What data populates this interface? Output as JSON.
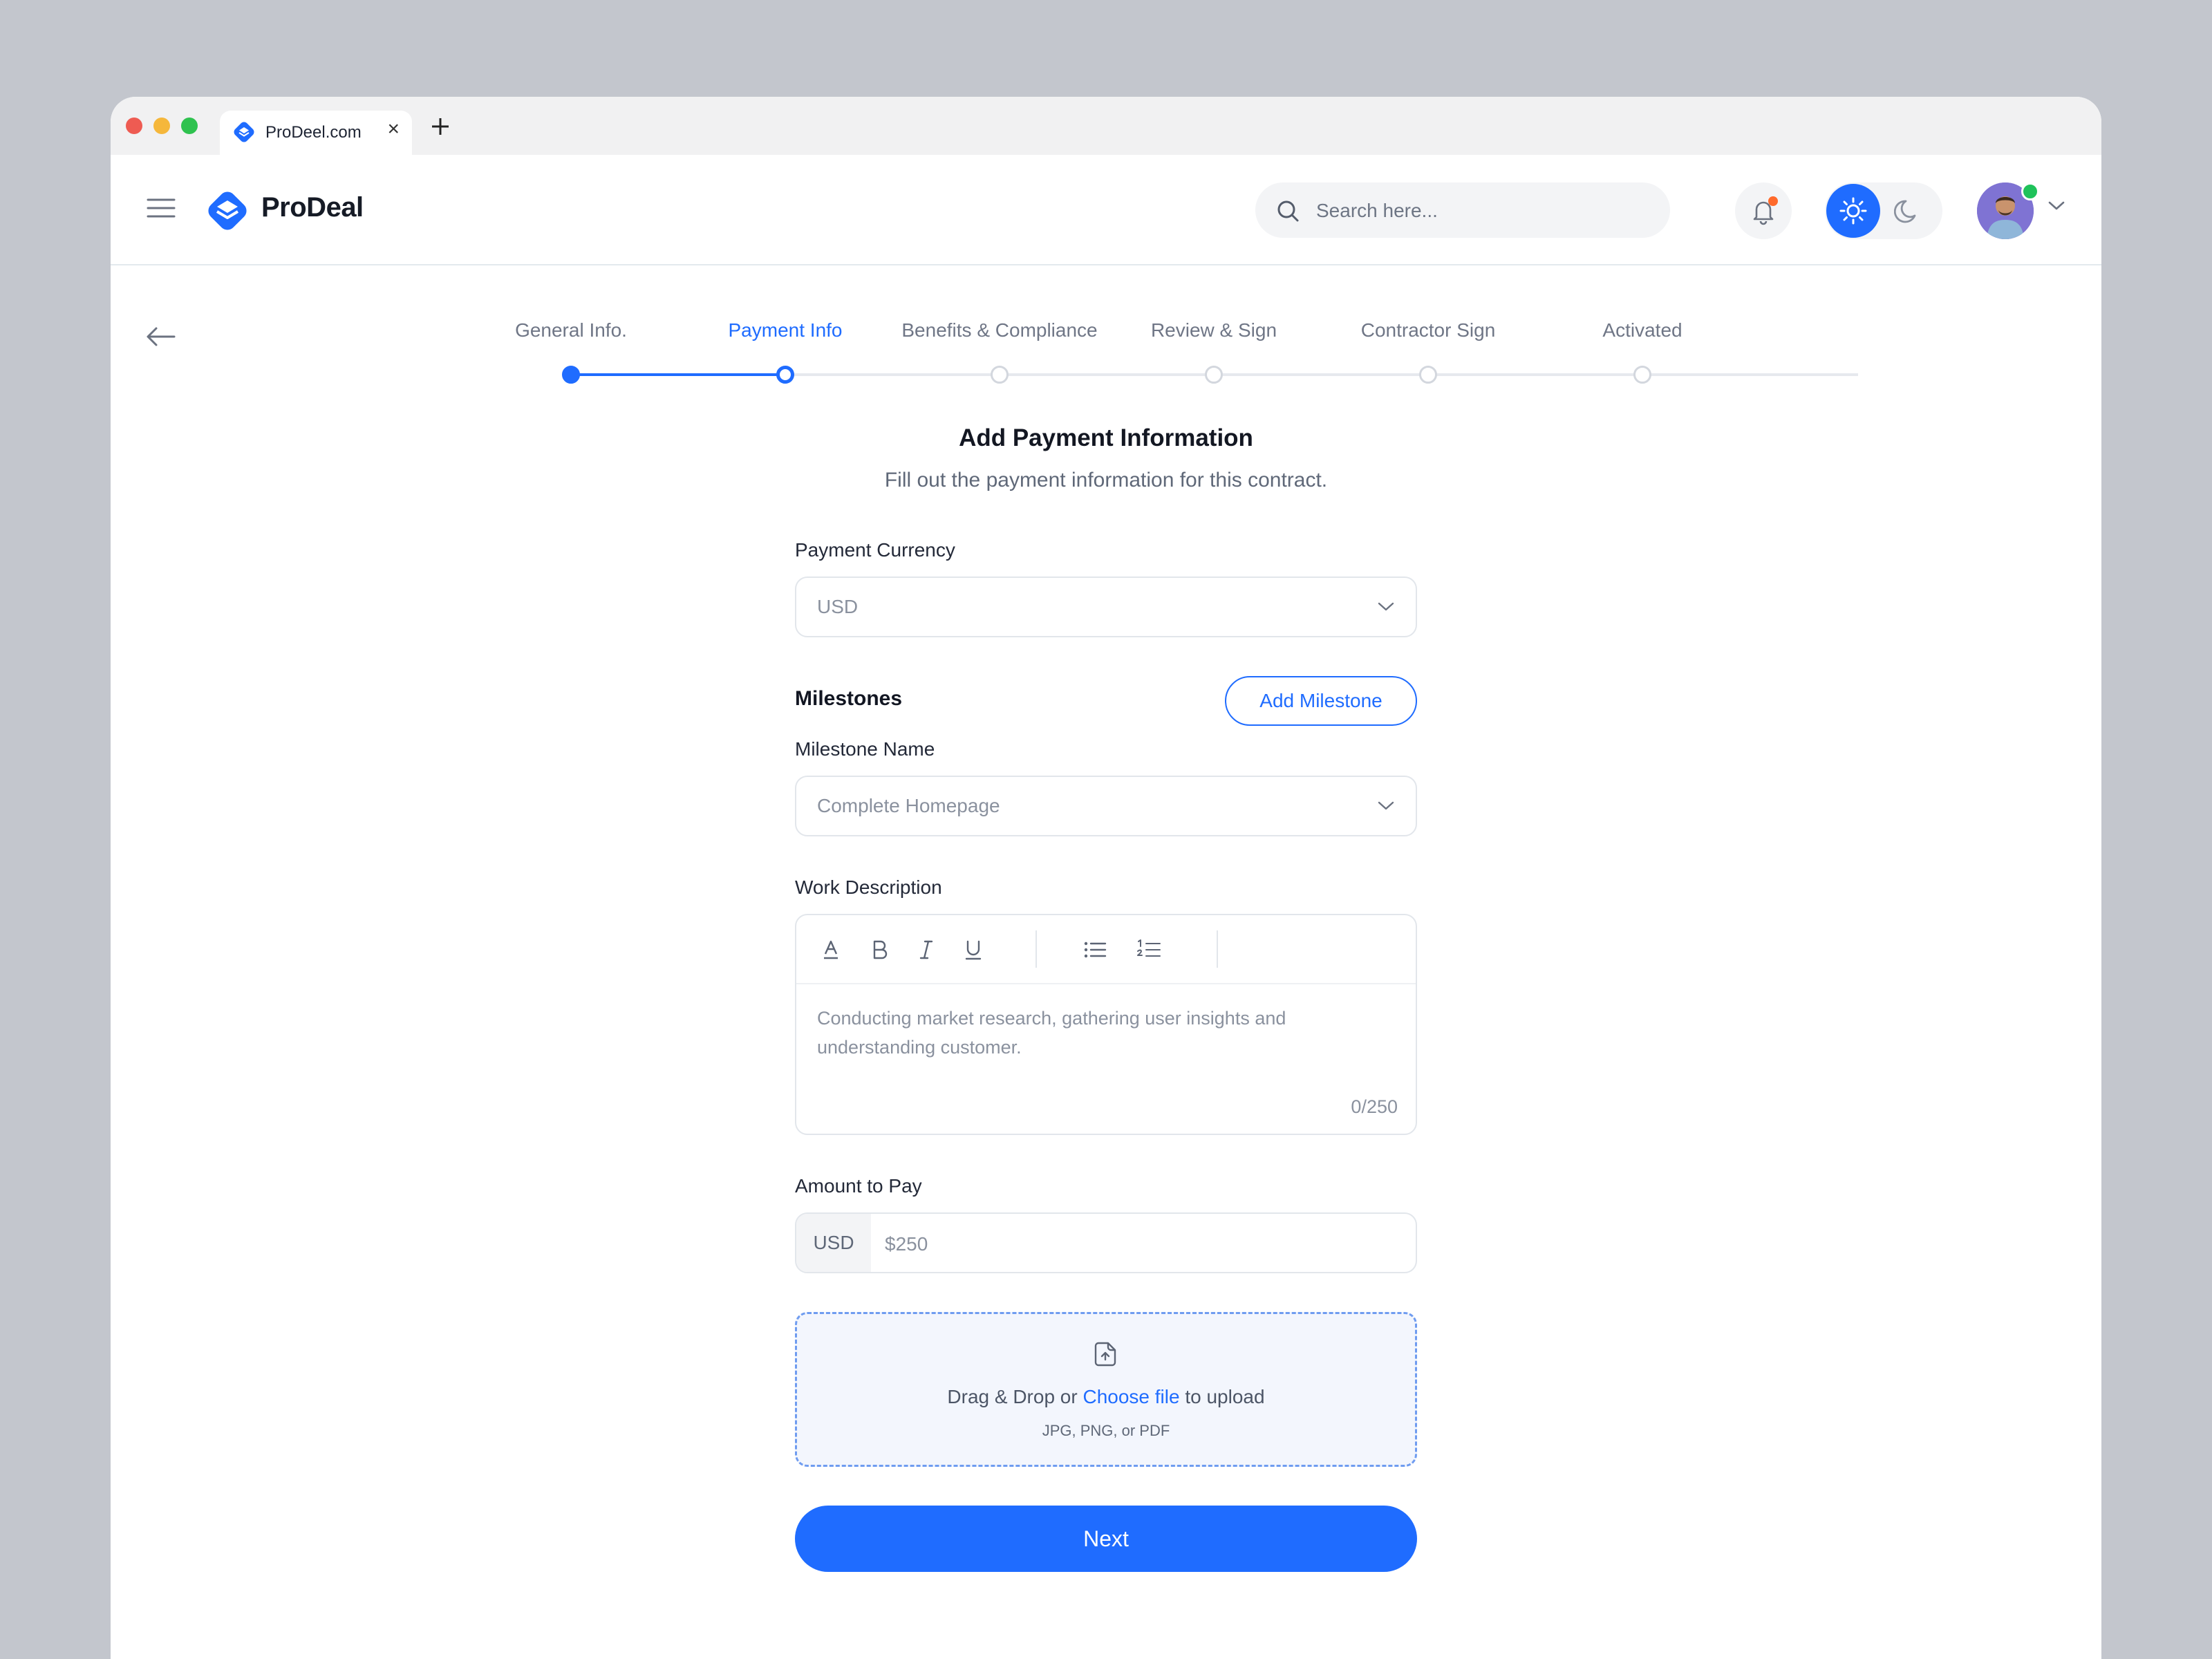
{
  "browser": {
    "tab_title": "ProDeel.com",
    "tab_close": "×"
  },
  "header": {
    "brand": "ProDeal",
    "search_placeholder": "Search here..."
  },
  "stepper": {
    "steps": [
      {
        "label": "General Info.",
        "state": "done"
      },
      {
        "label": "Payment Info",
        "state": "active"
      },
      {
        "label": "Benefits & Compliance",
        "state": "todo"
      },
      {
        "label": "Review & Sign",
        "state": "todo"
      },
      {
        "label": "Contractor Sign",
        "state": "todo"
      },
      {
        "label": "Activated",
        "state": "todo"
      }
    ]
  },
  "form": {
    "title": "Add Payment Information",
    "subtitle": "Fill out the payment information for this contract.",
    "currency_label": "Payment Currency",
    "currency_value": "USD",
    "milestones_heading": "Milestones",
    "add_milestone": "Add Milestone",
    "milestone_name_label": "Milestone Name",
    "milestone_name_value": "Complete Homepage",
    "work_description_label": "Work Description",
    "work_description_value": "Conducting market research, gathering user insights and understanding customer.",
    "char_count": "0/250",
    "amount_label": "Amount to Pay",
    "amount_currency": "USD",
    "amount_value": "$250",
    "upload_prefix": "Drag & Drop or ",
    "upload_link": "Choose file",
    "upload_suffix": " to upload",
    "upload_hint": "JPG, PNG, or PDF",
    "next": "Next"
  },
  "colors": {
    "accent": "#1f6cff",
    "notification": "#ff6a2c",
    "online": "#1fc25a"
  }
}
